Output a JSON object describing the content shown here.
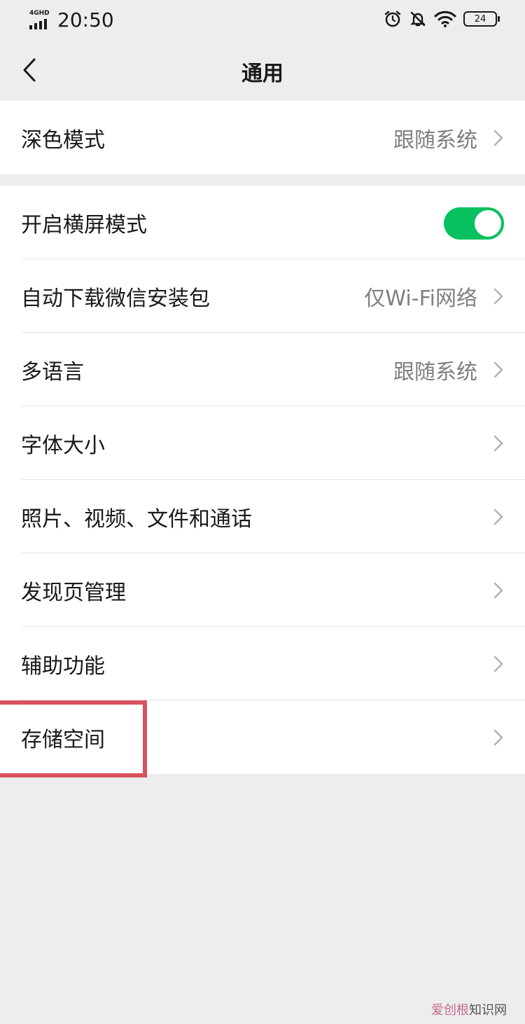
{
  "status_bar": {
    "network": "4GHD",
    "time": "20:50",
    "battery": "24"
  },
  "nav": {
    "title": "通用",
    "back_icon": "chevron-left-icon"
  },
  "group1": {
    "items": [
      {
        "label": "深色模式",
        "value": "跟随系统"
      }
    ]
  },
  "group2": {
    "items": [
      {
        "label": "开启横屏模式",
        "toggle_on": true
      },
      {
        "label": "自动下载微信安装包",
        "value": "仅Wi-Fi网络"
      },
      {
        "label": "多语言",
        "value": "跟随系统"
      },
      {
        "label": "字体大小"
      },
      {
        "label": "照片、视频、文件和通话"
      },
      {
        "label": "发现页管理"
      },
      {
        "label": "辅助功能"
      },
      {
        "label": "存储空间"
      }
    ]
  },
  "colors": {
    "toggle_on": "#07c160",
    "highlight": "#d9515e",
    "background": "#ededed"
  },
  "watermark": {
    "brand": "爱创根",
    "suffix": "知识网"
  }
}
